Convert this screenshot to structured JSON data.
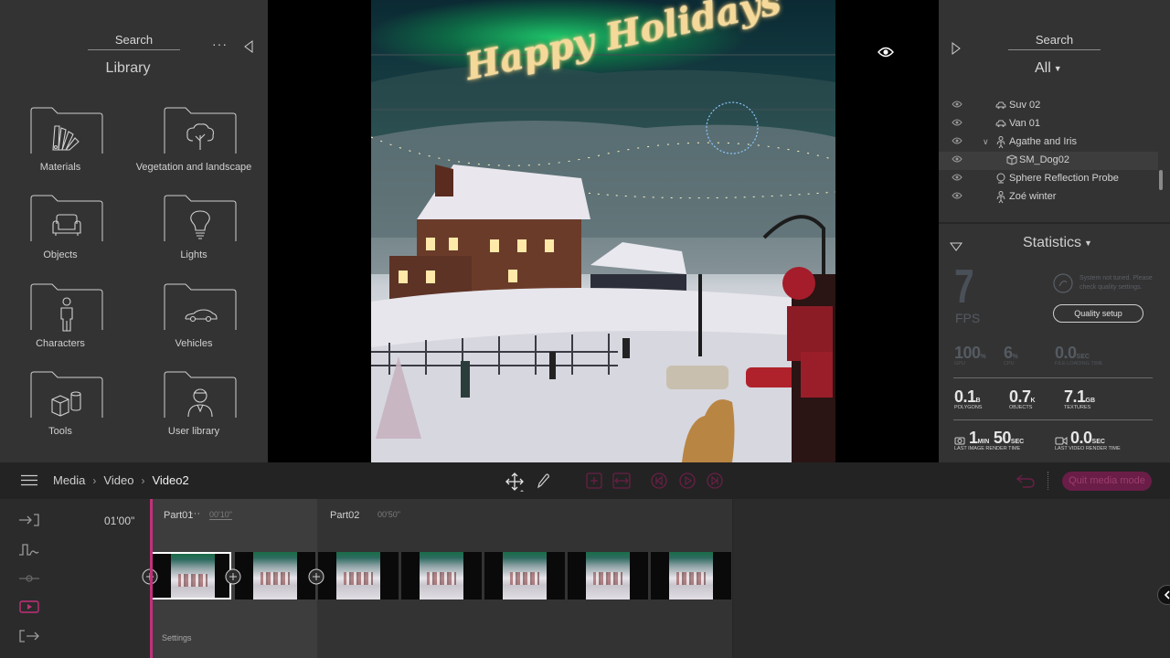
{
  "library": {
    "search_label": "Search",
    "more_label": "···",
    "title": "Library",
    "tiles": [
      {
        "label": "Materials",
        "icon": "materials-swatch-icon"
      },
      {
        "label": "Vegetation and landscape",
        "icon": "tree-icon"
      },
      {
        "label": "Objects",
        "icon": "sofa-icon"
      },
      {
        "label": "Lights",
        "icon": "lightbulb-icon"
      },
      {
        "label": "Characters",
        "icon": "person-icon"
      },
      {
        "label": "Vehicles",
        "icon": "car-icon"
      },
      {
        "label": "Tools",
        "icon": "cubes-icon"
      },
      {
        "label": "User library",
        "icon": "user-icon"
      }
    ]
  },
  "viewport": {
    "overlay_text": "Happy Holidays"
  },
  "scene_panel": {
    "search_label": "Search",
    "filter_value": "All",
    "tree": [
      {
        "label": "Suv 02",
        "icon": "car-icon",
        "depth": 0,
        "selected": false
      },
      {
        "label": "Van 01",
        "icon": "car-icon",
        "depth": 0,
        "selected": false
      },
      {
        "label": "Agathe and Iris",
        "icon": "person-icon",
        "depth": 0,
        "selected": false,
        "expanded": true
      },
      {
        "label": "SM_Dog02",
        "icon": "mesh-icon",
        "depth": 1,
        "selected": true
      },
      {
        "label": "Sphere Reflection Probe",
        "icon": "probe-icon",
        "depth": 0,
        "selected": false
      },
      {
        "label": "Zoé winter",
        "icon": "person-icon",
        "depth": 0,
        "selected": false
      }
    ]
  },
  "statistics": {
    "title": "Statistics",
    "fps_value": "7",
    "fps_label": "FPS",
    "quality_message": "System not tuned. Please check quality settings.",
    "quality_button": "Quality setup",
    "gpu": {
      "value": "100",
      "unit": "%",
      "label": "GPU"
    },
    "cpu": {
      "value": "6",
      "unit": "%",
      "label": "CPU"
    },
    "file_loading": {
      "value": "0.0",
      "unit": "SEC",
      "label": "File loading time"
    },
    "polygons": {
      "value": "0.1",
      "unit": "B",
      "label": "Polygons"
    },
    "objects": {
      "value": "0.7",
      "unit": "K",
      "label": "Objects"
    },
    "textures": {
      "value": "7.1",
      "unit": "GB",
      "label": "Textures"
    },
    "last_image": {
      "value_min": "1",
      "unit_min": "MIN",
      "value_sec": "50",
      "unit_sec": "SEC",
      "label": "Last image render time"
    },
    "last_video": {
      "value": "0.0",
      "unit": "SEC",
      "label": "Last video render time"
    }
  },
  "toolbar": {
    "breadcrumb": [
      "Media",
      "Video",
      "Video2"
    ],
    "quit_label": "Quit media mode"
  },
  "timeline": {
    "duration": "01'00\"",
    "parts": [
      {
        "label": "Part01",
        "time": "00'10\""
      },
      {
        "label": "Part02",
        "time": "00'50\""
      }
    ],
    "settings_label": "Settings",
    "clip_count": 7,
    "selected_clip": 0
  },
  "colors": {
    "accent": "#c1317a",
    "panel": "#333333",
    "toolbar": "#232323"
  }
}
